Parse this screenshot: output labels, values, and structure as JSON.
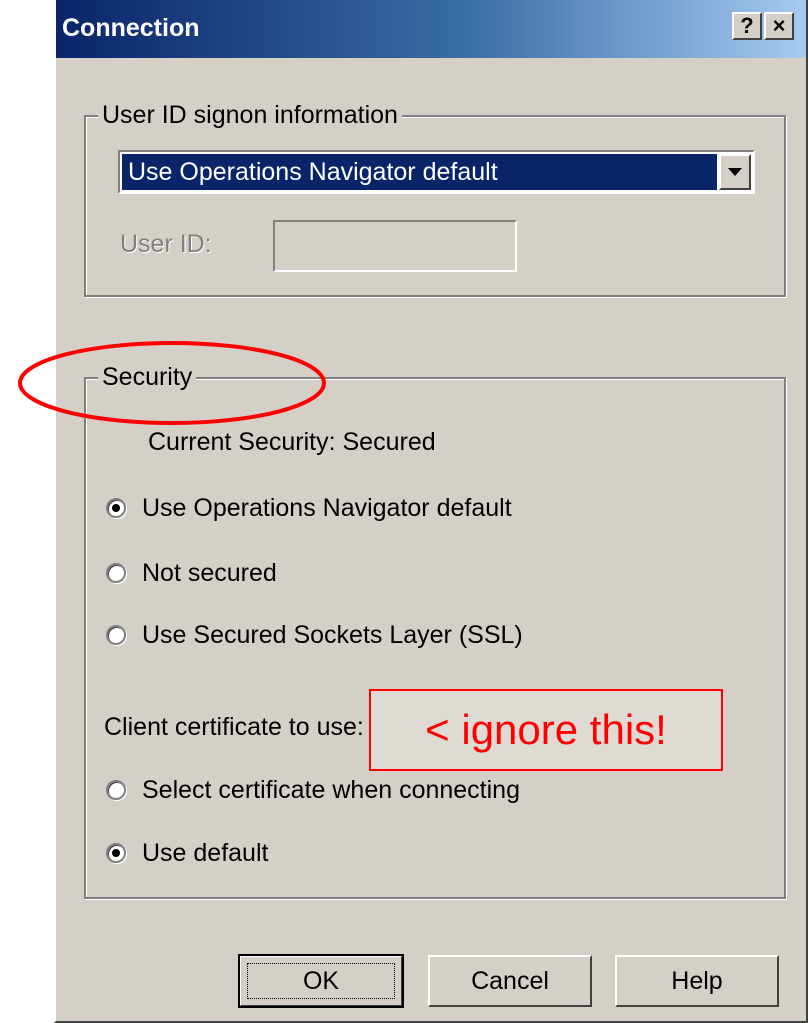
{
  "dialog": {
    "title": "Connection",
    "help_button": "?",
    "close_button": "×"
  },
  "signon_group": {
    "legend": "User ID signon information",
    "dropdown_value": "Use Operations Navigator default",
    "user_id_label": "User ID:",
    "user_id_value": ""
  },
  "security_group": {
    "legend": "Security",
    "current_security": "Current Security:  Secured",
    "options": [
      {
        "label": "Use Operations Navigator default",
        "selected": true
      },
      {
        "label": "Not secured",
        "selected": false
      },
      {
        "label": "Use Secured Sockets Layer (SSL)",
        "selected": false
      }
    ],
    "certificate_label": "Client certificate to use:",
    "certificate_options": [
      {
        "label": "Select certificate when connecting",
        "selected": false
      },
      {
        "label": "Use default",
        "selected": true
      }
    ]
  },
  "buttons": {
    "ok": "OK",
    "cancel": "Cancel",
    "help": "Help"
  },
  "annotation": {
    "text": "< ignore this!",
    "color": "#ff0000"
  },
  "colors": {
    "dialog_bg": "#d4d0c8",
    "title_start": "#0a246a",
    "title_end": "#a6caf0",
    "selection": "#0a246a"
  }
}
